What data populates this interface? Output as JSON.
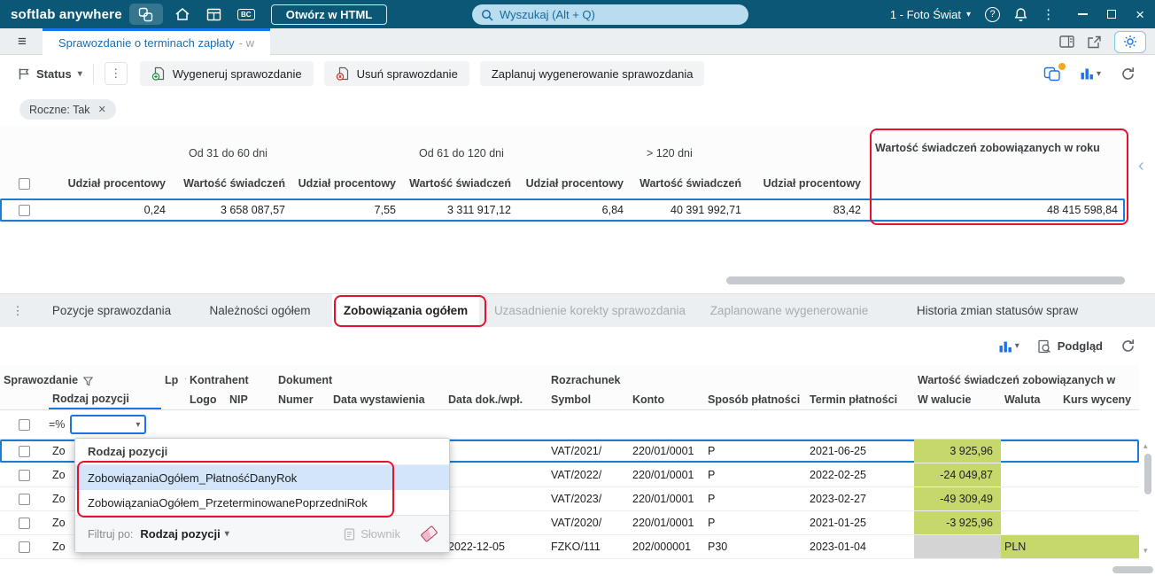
{
  "topbar": {
    "brand": "softlab anywhere",
    "bc": "BC",
    "open_html": "Otwórz w HTML",
    "search_placeholder": "Wyszukaj (Alt + Q)",
    "company": "1 - Foto Świat"
  },
  "tabbar": {
    "tab_title": "Sprawozdanie o terminach zapłaty",
    "tab_suffix": "- w"
  },
  "toolbar": {
    "status": "Status",
    "generate": "Wygeneruj sprawozdanie",
    "remove": "Usuń sprawozdanie",
    "schedule": "Zaplanuj wygenerowanie sprawozdania"
  },
  "filters": {
    "chip": "Roczne: Tak"
  },
  "upper_grid": {
    "group_31_60": "Od 31 do 60 dni",
    "group_61_120": "Od 61 do 120 dni",
    "group_120": "> 120 dni",
    "year_column": "Wartość świadczeń zobowiązanych w roku",
    "sub_udzial": "Udział procentowy",
    "sub_wartosc": "Wartość świadczeń",
    "row": {
      "u0": "0,24",
      "w1": "3 658 087,57",
      "u1": "7,55",
      "w2": "3 311 917,12",
      "u2": "6,84",
      "w3": "40 391 992,71",
      "u3": "83,42",
      "wy": "48 415 598,84"
    }
  },
  "detail_tabs": {
    "t1": "Pozycje sprawozdania",
    "t2": "Należności ogółem",
    "t3": "Zobowiązania ogółem",
    "t4": "Uzasadnienie korekty sprawozdania",
    "t5": "Zaplanowane wygenerowanie",
    "t6": "Historia zmian statusów spraw"
  },
  "lower_toolbar": {
    "preview": "Podgląd"
  },
  "lower_grid": {
    "h1": {
      "sprawozdanie": "Sprawozdanie",
      "lp": "Lp",
      "kontrahent": "Kontrahent",
      "dokument": "Dokument",
      "rozrachunek": "Rozrachunek",
      "wartosc": "Wartość świadczeń zobowiązanych w"
    },
    "h2": {
      "rodzaj": "Rodzaj pozycji",
      "logo": "Logo",
      "nip": "NIP",
      "numer": "Numer",
      "data_wyst": "Data wystawienia",
      "data_dok": "Data dok./wpł.",
      "symbol": "Symbol",
      "konto": "Konto",
      "sposob": "Sposób płatności",
      "termin": "Termin płatności",
      "w_walucie": "W walucie",
      "waluta": "Waluta",
      "kurs": "Kurs wyceny"
    },
    "filter_operator": "=%",
    "rows": [
      {
        "rodzaj": "Zo",
        "symbol": "VAT/2021/",
        "konto": "220/01/0001",
        "sposob": "P",
        "termin": "2021-06-25",
        "w_walucie": "3 925,96"
      },
      {
        "rodzaj": "Zo",
        "symbol": "VAT/2022/",
        "konto": "220/01/0001",
        "sposob": "P",
        "termin": "2022-02-25",
        "w_walucie": "-24 049,87"
      },
      {
        "rodzaj": "Zo",
        "symbol": "VAT/2023/",
        "konto": "220/01/0001",
        "sposob": "P",
        "termin": "2023-02-27",
        "w_walucie": "-49 309,49"
      },
      {
        "rodzaj": "Zo",
        "symbol": "VAT/2020/",
        "konto": "220/01/0001",
        "sposob": "P",
        "termin": "2021-01-25",
        "w_walucie": "-3 925,96"
      },
      {
        "rodzaj": "Zo",
        "data_dok": "2022-12-05",
        "symbol": "FZKO/111",
        "konto": "202/000001",
        "sposob": "P30",
        "termin": "2023-01-04",
        "w_walucie": "",
        "waluta": "PLN"
      }
    ]
  },
  "dropdown": {
    "title": "Rodzaj pozycji",
    "option1": "ZobowiązaniaOgółem_PłatnośćDanyRok",
    "option2": "ZobowiązaniaOgółem_PrzeterminowanePoprzedniRok",
    "filter_by": "Filtruj po:",
    "filter_field": "Rodzaj pozycji",
    "dictionary": "Słownik"
  },
  "colors": {
    "topbar": "#0a5776",
    "accent_blue": "#1a73e8",
    "green_cell": "#c6d86b",
    "gray_cell": "#d4d4d4",
    "annotation_red": "#e8112d",
    "selection_blue": "#1f7ad4"
  }
}
